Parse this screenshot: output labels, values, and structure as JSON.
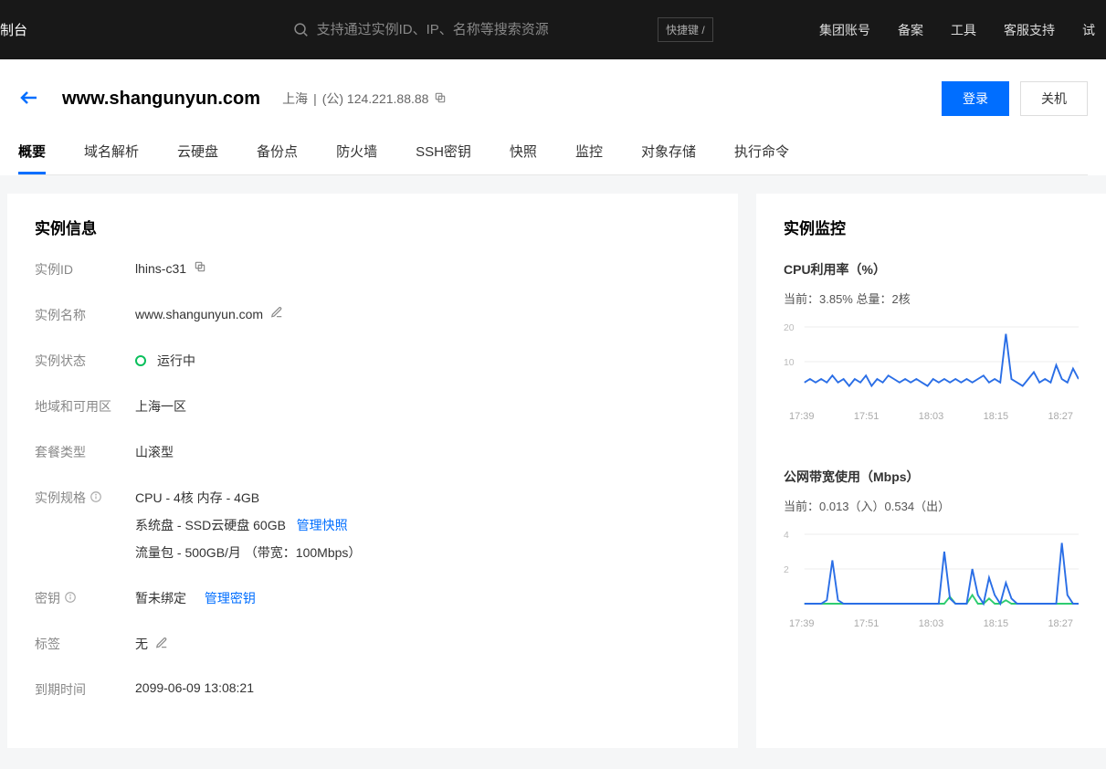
{
  "topbar": {
    "logo": "制台",
    "search_placeholder": "支持通过实例ID、IP、名称等搜索资源",
    "shortcut": "快捷键 /",
    "links": [
      "集团账号",
      "备案",
      "工具",
      "客服支持",
      "试"
    ]
  },
  "header": {
    "title": "www.shangunyun.com",
    "region": "上海",
    "ip_label": "(公) 124.221.88.88",
    "actions": {
      "login": "登录",
      "shutdown": "关机"
    }
  },
  "tabs": [
    "概要",
    "域名解析",
    "云硬盘",
    "备份点",
    "防火墙",
    "SSH密钥",
    "快照",
    "监控",
    "对象存储",
    "执行命令"
  ],
  "active_tab": 0,
  "info": {
    "card_title": "实例信息",
    "rows": {
      "instance_id": {
        "label": "实例ID",
        "value": "lhins-c31"
      },
      "instance_name": {
        "label": "实例名称",
        "value": "www.shangunyun.com"
      },
      "status": {
        "label": "实例状态",
        "value": "运行中"
      },
      "zone": {
        "label": "地域和可用区",
        "value": "上海一区"
      },
      "package": {
        "label": "套餐类型",
        "value": "山滚型"
      },
      "spec": {
        "label": "实例规格",
        "lines": [
          "CPU - 4核 内存 - 4GB",
          "系统盘 - SSD云硬盘 60GB",
          "流量包 - 500GB/月 （带宽：100Mbps）"
        ],
        "snapshot_link": "管理快照"
      },
      "key": {
        "label": "密钥",
        "value": "暂未绑定",
        "link": "管理密钥"
      },
      "tag": {
        "label": "标签",
        "value": "无"
      },
      "expire": {
        "label": "到期时间",
        "value": "2099-06-09 13:08:21"
      }
    }
  },
  "monitor": {
    "card_title": "实例监控",
    "cpu": {
      "title": "CPU利用率（%）",
      "sub": "当前：3.85% 总量：2核"
    },
    "net": {
      "title": "公网带宽使用（Mbps）",
      "sub": "当前：0.013（入）0.534（出）"
    }
  },
  "chart_data": [
    {
      "type": "line",
      "title": "CPU利用率（%）",
      "ylabel": "%",
      "xlabel": "",
      "ylim": [
        0,
        20
      ],
      "y_ticks": [
        10,
        20
      ],
      "x_ticks": [
        "17:39",
        "17:51",
        "18:03",
        "18:15",
        "18:27"
      ],
      "series": [
        {
          "name": "CPU",
          "color": "#2a6ee6",
          "values": [
            4,
            5,
            4,
            5,
            4,
            6,
            4,
            5,
            3,
            5,
            4,
            6,
            3,
            5,
            4,
            6,
            5,
            4,
            5,
            4,
            5,
            4,
            3,
            5,
            4,
            5,
            4,
            5,
            4,
            5,
            4,
            5,
            6,
            4,
            5,
            4,
            18,
            5,
            4,
            3,
            5,
            7,
            4,
            5,
            4,
            9,
            5,
            4,
            8,
            5
          ]
        }
      ]
    },
    {
      "type": "line",
      "title": "公网带宽使用（Mbps）",
      "ylabel": "Mbps",
      "xlabel": "",
      "ylim": [
        0,
        4
      ],
      "y_ticks": [
        2,
        4
      ],
      "x_ticks": [
        "17:39",
        "17:51",
        "18:03",
        "18:15",
        "18:27"
      ],
      "series": [
        {
          "name": "入",
          "color": "#2ecc71",
          "values": [
            0,
            0,
            0,
            0,
            0,
            0,
            0,
            0,
            0,
            0,
            0,
            0,
            0,
            0,
            0,
            0,
            0,
            0,
            0,
            0,
            0,
            0,
            0,
            0,
            0,
            0,
            0.4,
            0,
            0,
            0,
            0.5,
            0,
            0,
            0.3,
            0,
            0,
            0.2,
            0,
            0,
            0,
            0,
            0,
            0,
            0,
            0,
            0,
            0,
            0,
            0,
            0
          ]
        },
        {
          "name": "出",
          "color": "#2a6ee6",
          "values": [
            0,
            0,
            0,
            0,
            0.2,
            2.5,
            0.2,
            0,
            0,
            0,
            0,
            0,
            0,
            0,
            0,
            0,
            0,
            0,
            0,
            0,
            0,
            0,
            0,
            0,
            0,
            3,
            0.3,
            0,
            0,
            0,
            2,
            0.5,
            0,
            1.5,
            0.5,
            0,
            1.2,
            0.3,
            0,
            0,
            0,
            0,
            0,
            0,
            0,
            0,
            3.5,
            0.5,
            0,
            0
          ]
        }
      ]
    }
  ]
}
